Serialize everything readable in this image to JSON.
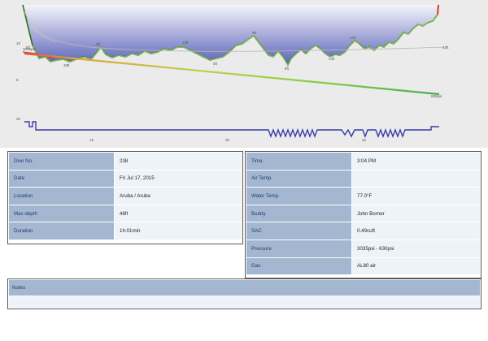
{
  "profile": {
    "left_axis_ticks": [
      "10",
      "5",
      "20"
    ],
    "depth_labels": [
      "6ft",
      "48ft",
      "0ft",
      "11ft",
      "5ft",
      "9ft",
      "8ft",
      "14ft",
      "41ft",
      "42ft"
    ],
    "pressure_labels": [
      "3035psi",
      "630psi"
    ],
    "time_labels": [
      "15",
      "30",
      "45"
    ],
    "colors": {
      "area_top": "#5a63b8",
      "area_bottom": "#f2f2f8",
      "profile_line": "#2e6b1e",
      "gas_line": "#c8d84a",
      "tank_line": "#3a3aa8",
      "ascent_red": "#d93a2a"
    }
  },
  "left": [
    {
      "label": "Dive No.",
      "value": "238"
    },
    {
      "label": "Date",
      "value": "Fri Jul 17, 2015"
    },
    {
      "label": "Location",
      "value": "Aruba / Aruba"
    },
    {
      "label": "Max depth",
      "value": "46ft"
    },
    {
      "label": "Duration",
      "value": "1h:01min"
    }
  ],
  "right": [
    {
      "label": "Time.",
      "value": "3:04 PM"
    },
    {
      "label": "Air Temp.",
      "value": ""
    },
    {
      "label": "Water Temp.",
      "value": "77.0°F"
    },
    {
      "label": "Buddy",
      "value": "John Borner"
    },
    {
      "label": "SAC",
      "value": "0.49cuft"
    },
    {
      "label": "Pressure",
      "value": "3035psi - 630psi"
    },
    {
      "label": "Gas",
      "value": "AL80 air"
    }
  ],
  "notes": {
    "label": "Notes",
    "text": ""
  }
}
